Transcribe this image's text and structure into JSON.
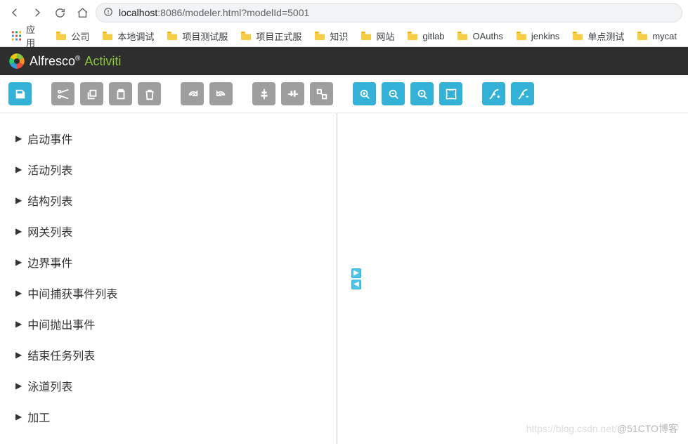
{
  "browser": {
    "url_host": "localhost",
    "url_port": ":8086",
    "url_path": "/modeler.html?modelId=5001"
  },
  "bookmarks": {
    "apps_label": "应用",
    "items": [
      {
        "label": "公司"
      },
      {
        "label": "本地调试"
      },
      {
        "label": "项目测试服"
      },
      {
        "label": "项目正式服"
      },
      {
        "label": "知识"
      },
      {
        "label": "网站"
      },
      {
        "label": "gitlab"
      },
      {
        "label": "OAuths"
      },
      {
        "label": "jenkins"
      },
      {
        "label": "单点测试"
      },
      {
        "label": "mycat"
      }
    ]
  },
  "header": {
    "brand_primary": "Alfresco",
    "brand_secondary": "Activiti"
  },
  "toolbar": {
    "buttons": [
      {
        "name": "save",
        "group": 0,
        "style": "blue",
        "icon": "floppy"
      },
      {
        "name": "cut",
        "group": 1,
        "style": "gray",
        "icon": "scissors"
      },
      {
        "name": "copy",
        "group": 1,
        "style": "gray",
        "icon": "copy"
      },
      {
        "name": "paste",
        "group": 1,
        "style": "gray",
        "icon": "paste"
      },
      {
        "name": "delete",
        "group": 1,
        "style": "gray",
        "icon": "trash"
      },
      {
        "name": "redo",
        "group": 2,
        "style": "gray",
        "icon": "redo"
      },
      {
        "name": "undo",
        "group": 2,
        "style": "gray",
        "icon": "undo"
      },
      {
        "name": "align-vertical",
        "group": 3,
        "style": "gray",
        "icon": "alignv"
      },
      {
        "name": "align-horizontal",
        "group": 3,
        "style": "gray",
        "icon": "alignh"
      },
      {
        "name": "same-size",
        "group": 3,
        "style": "gray",
        "icon": "samesize"
      },
      {
        "name": "zoom-in",
        "group": 4,
        "style": "blue",
        "icon": "zoomin"
      },
      {
        "name": "zoom-out",
        "group": 4,
        "style": "blue",
        "icon": "zoomout"
      },
      {
        "name": "zoom-reset",
        "group": 4,
        "style": "blue",
        "icon": "zoomreset"
      },
      {
        "name": "zoom-fit",
        "group": 4,
        "style": "blue",
        "icon": "zoomfit"
      },
      {
        "name": "add-bendpoint",
        "group": 5,
        "style": "blue",
        "icon": "bendadd"
      },
      {
        "name": "remove-bendpoint",
        "group": 5,
        "style": "blue",
        "icon": "bendremove"
      }
    ]
  },
  "palette": {
    "items": [
      {
        "label": "启动事件"
      },
      {
        "label": "活动列表"
      },
      {
        "label": "结构列表"
      },
      {
        "label": "网关列表"
      },
      {
        "label": "边界事件"
      },
      {
        "label": "中间捕获事件列表"
      },
      {
        "label": "中间抛出事件"
      },
      {
        "label": "结束任务列表"
      },
      {
        "label": "泳道列表"
      },
      {
        "label": "加工"
      }
    ]
  },
  "watermark": {
    "faint": "https://blog.csdn.net/",
    "text": "@51CTO博客"
  }
}
